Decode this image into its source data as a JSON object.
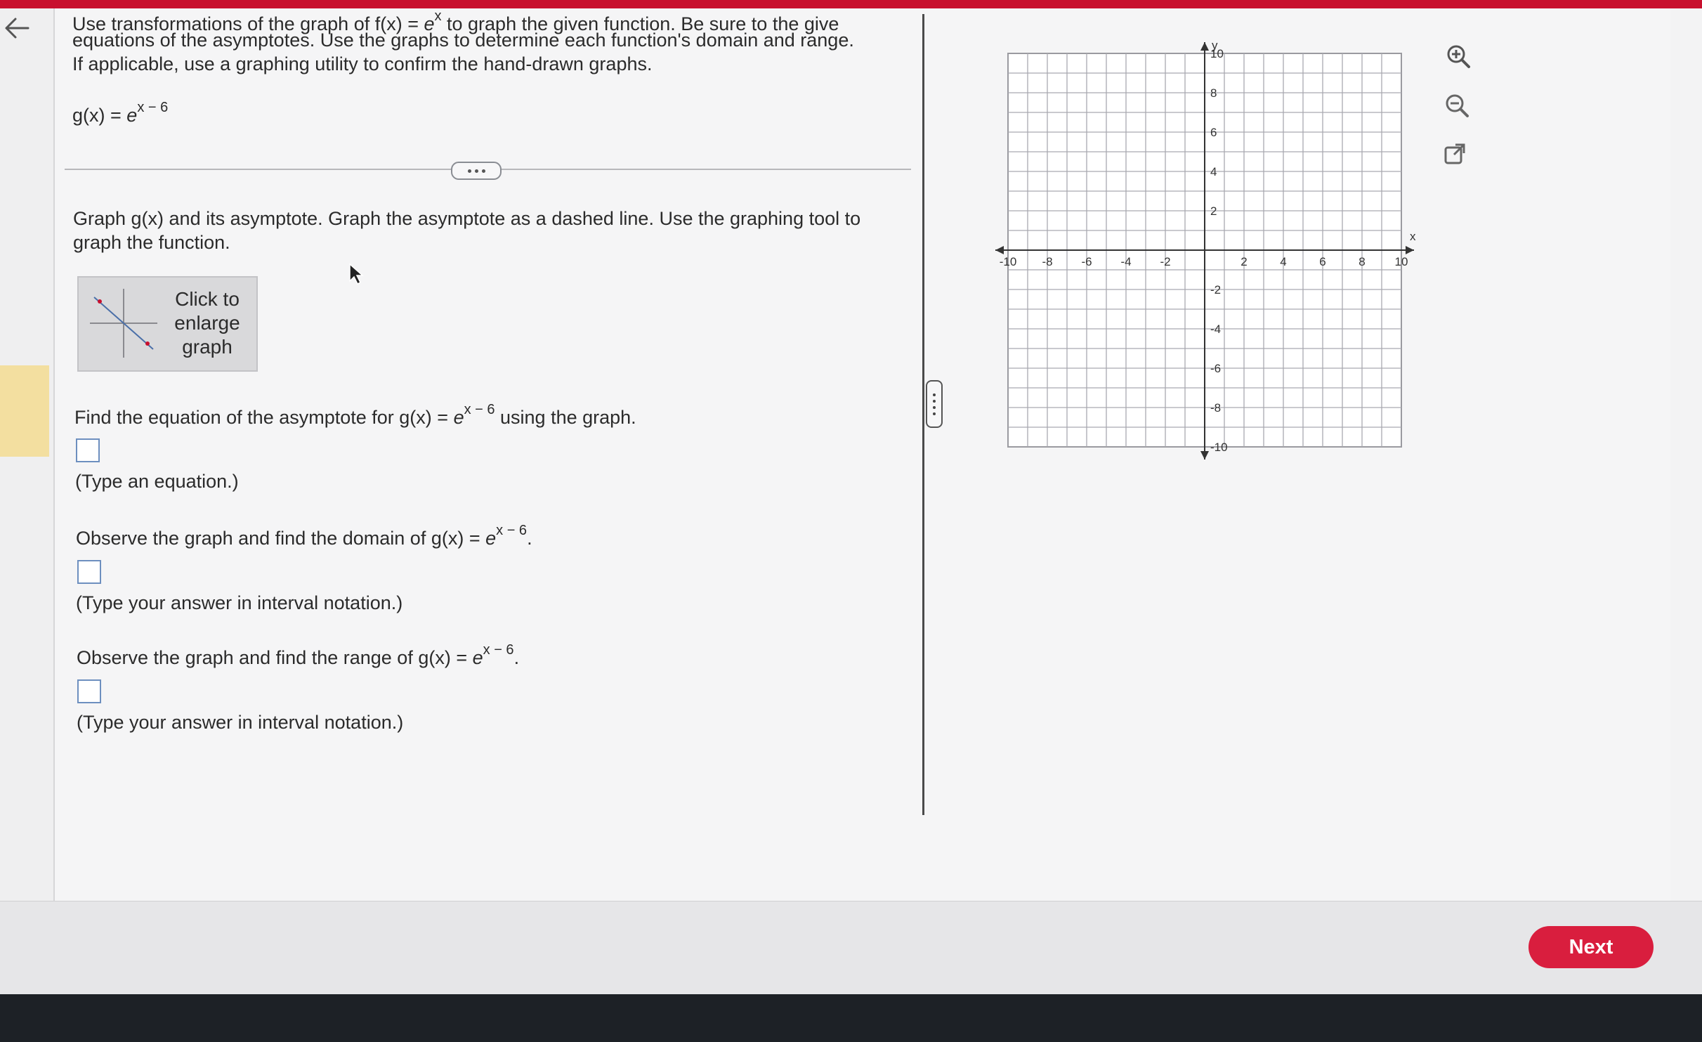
{
  "question": {
    "intro_line1_a": "Use transformations of the graph of f(x) = ",
    "intro_line1_e": "e",
    "intro_line1_sup": "x",
    "intro_line1_b": " to graph the given function. Be sure to the give",
    "intro_line2": "equations of the asymptotes. Use the graphs to determine each function's domain and range.",
    "intro_line3": "If applicable, use a graphing utility to confirm the hand-drawn graphs.",
    "function_lhs": "g(x) = ",
    "function_e": "e",
    "function_exp": "x − 6"
  },
  "part1": {
    "line1": "Graph g(x) and its asymptote. Graph the asymptote as a dashed line. Use the graphing tool to",
    "line2": "graph the function.",
    "enlarge_label": "Click to enlarge graph"
  },
  "part2": {
    "prompt_a": "Find the equation of the asymptote for g(x) = ",
    "prompt_e": "e",
    "prompt_exp": "x − 6",
    "prompt_b": " using the graph.",
    "hint": "(Type an equation.)"
  },
  "part3": {
    "prompt_a": "Observe the graph and find the domain of g(x) = ",
    "prompt_e": "e",
    "prompt_exp": "x − 6",
    "prompt_b": ".",
    "hint": "(Type your answer in interval notation.)"
  },
  "part4": {
    "prompt_a": "Observe the graph and find the range of g(x) = ",
    "prompt_e": "e",
    "prompt_exp": "x − 6",
    "prompt_b": ".",
    "hint": "(Type your answer in interval notation.)"
  },
  "graph": {
    "x_label": "x",
    "y_label": "y",
    "x_ticks": [
      "-10",
      "-8",
      "-6",
      "-4",
      "-2",
      "2",
      "4",
      "6",
      "8",
      "10"
    ],
    "y_ticks": [
      "10",
      "8",
      "6",
      "4",
      "2",
      "-2",
      "-4",
      "-6",
      "-8",
      "-10"
    ]
  },
  "tools": {
    "zoom_in_icon": "zoom-in-icon",
    "zoom_out_icon": "zoom-out-icon",
    "popout_icon": "external-link-icon"
  },
  "footer": {
    "next_label": "Next"
  },
  "colors": {
    "accent": "#d91e3e",
    "top_bar": "#c8102e",
    "rail_highlight": "#f3dfa0",
    "answer_box_border": "#6d8fbf"
  }
}
